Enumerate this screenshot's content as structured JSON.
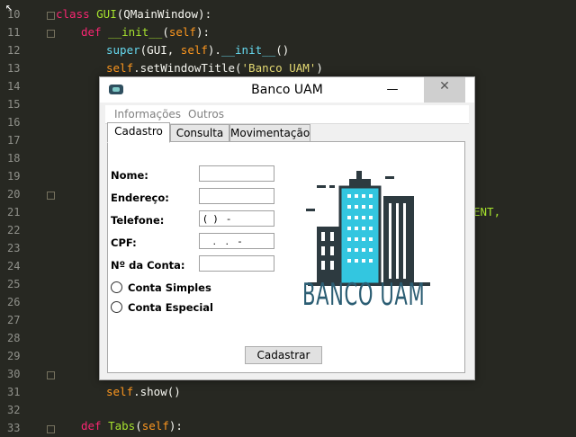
{
  "editor": {
    "line_numbers": [
      "10",
      "11",
      "12",
      "13",
      "14",
      "15",
      "16",
      "17",
      "18",
      "19",
      "20",
      "21",
      "22",
      "23",
      "24",
      "25",
      "26",
      "27",
      "28",
      "29",
      "30",
      "31",
      "32",
      "33"
    ],
    "line10": {
      "kw": "class ",
      "cls": "GUI",
      "rest": "(QMainWindow):"
    },
    "line11": {
      "kw": "def ",
      "fn": "__init__",
      "p1": "(",
      "self": "self",
      "p2": "):"
    },
    "line12": {
      "bi": "super",
      "p1": "(GUI, ",
      "self": "self",
      "p2": ").",
      "fn": "__init__",
      "p3": "()"
    },
    "line13": {
      "self": "self",
      "p1": ".setWindowTitle(",
      "st": "'Banco UAM'",
      "p2": ")"
    },
    "line21_tail": "ENT,",
    "line31": {
      "self": "self",
      "rest": ".show()"
    },
    "line33": {
      "kw": "def ",
      "fn": "Tabs",
      "p1": "(",
      "self": "self",
      "p2": "):"
    }
  },
  "window": {
    "title": "Banco UAM",
    "minimize": "—",
    "close": "✕",
    "menu": [
      "Informações",
      "Outros"
    ],
    "tabs": [
      "Cadastro",
      "Consulta",
      "Movimentação"
    ],
    "form": {
      "nome_label": "Nome:",
      "endereco_label": "Endereço:",
      "telefone_label": "Telefone:",
      "telefone_value": "(  )   -",
      "cpf_label": "CPF:",
      "cpf_value": "   .   .   -",
      "conta_label": "Nº da Conta:",
      "radio_simples": "Conta Simples",
      "radio_especial": "Conta Especial",
      "submit": "Cadastrar"
    },
    "logo_text": "BANCO UAM"
  },
  "colors": {
    "logo_dark": "#2d3a40",
    "logo_accent": "#33c6e0",
    "logo_text": "#2b5d73",
    "close_button": "#e81123"
  }
}
